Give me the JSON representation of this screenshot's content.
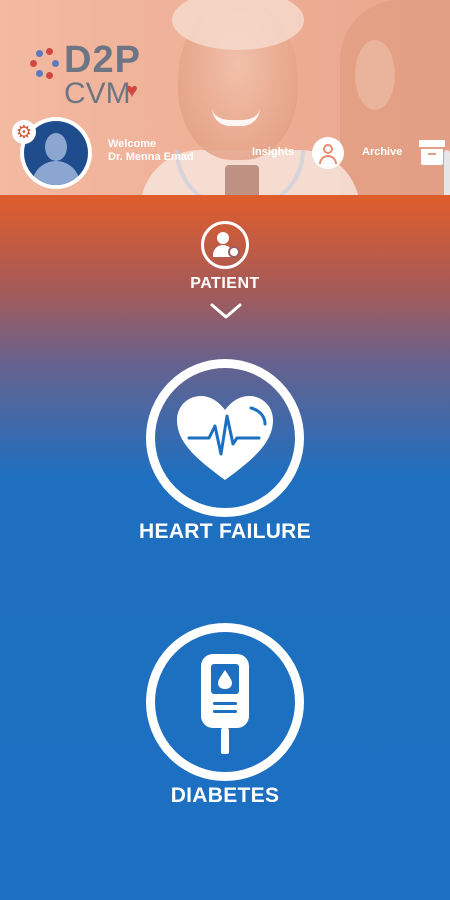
{
  "header": {
    "logo": {
      "line1": "D2P",
      "line2": "CVM"
    },
    "welcome": {
      "greeting": "Welcome",
      "user_name": "Dr. Menna Emad"
    },
    "nav": {
      "insights_label": "Insights",
      "archive_label": "Archive"
    }
  },
  "patient": {
    "label": "PATIENT"
  },
  "categories": [
    {
      "label": "HEART FAILURE",
      "icon": "heart-rate-icon"
    },
    {
      "label": "DIABETES",
      "icon": "glucose-meter-icon"
    }
  ],
  "colors": {
    "header_bg": "#efb198",
    "gradient_top": "#e05d2b",
    "primary_blue": "#1c6fc1",
    "logo_gray": "#6d7585",
    "avatar_bg": "#1f4c8c"
  }
}
